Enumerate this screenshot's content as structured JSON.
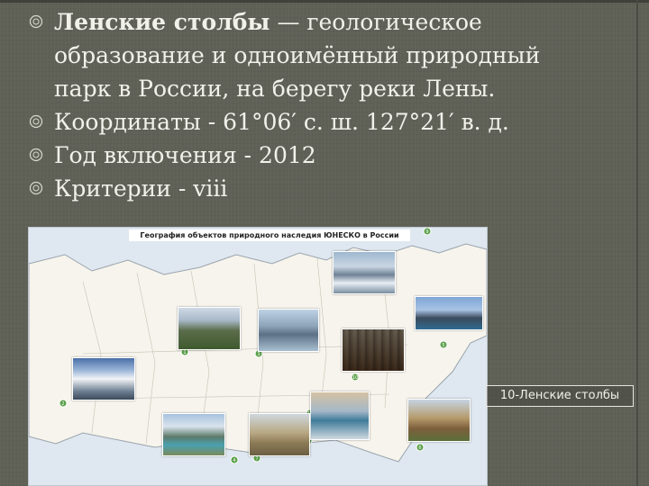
{
  "bullets": [
    {
      "lead": "Ленские столбы",
      "text": " — геологическое",
      "continuation": [
        "образование и одноимённый природный",
        "парк в России, на берегу реки Лены."
      ]
    },
    {
      "lead": "",
      "text": "Координаты - 61°06′ с. ш. 127°21′ в. д.",
      "continuation": []
    },
    {
      "lead": "",
      "text": "Год включения - 2012",
      "continuation": []
    },
    {
      "lead": "",
      "text": " Критерии - viii",
      "continuation": []
    }
  ],
  "map": {
    "title": "География объектов природного наследия ЮНЕСКО в России",
    "marker_labels": [
      "1",
      "2",
      "3",
      "4",
      "5",
      "6",
      "7",
      "8",
      "9",
      "10",
      "11"
    ]
  },
  "caption": "10-Ленские столбы",
  "colors": {
    "background": "#5f6157",
    "text": "#f1f1ea",
    "map_water": "#dfe7f0",
    "map_land": "#f6f4ec",
    "marker": "#5aa04a"
  }
}
